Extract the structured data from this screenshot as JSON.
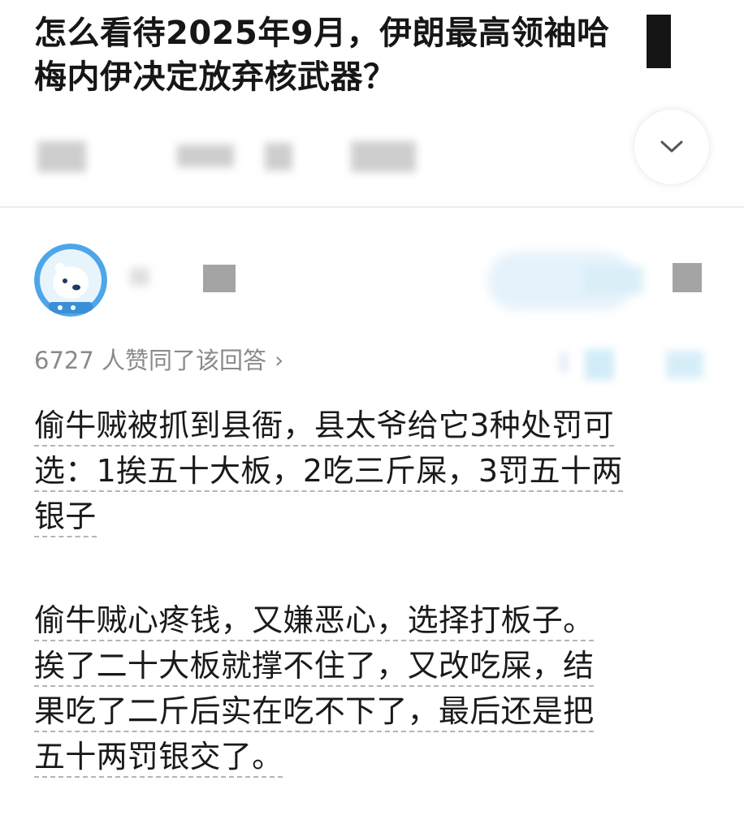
{
  "question": {
    "title_line1": "怎么看待2025年9月，伊朗最高领袖哈",
    "title_line2": "梅内伊决定放弃核武器？"
  },
  "icons": {
    "expand": "chevron-down-icon",
    "upvote_more": "chevron-right-icon",
    "avatar": "polar-bear-astronaut-avatar"
  },
  "answer": {
    "upvote_text": "6727 人赞同了该回答",
    "paragraph1": [
      "偷牛贼被抓到县衙，县太爷给它3种处罚可",
      "选：1挨五十大板，2吃三斤屎，3罚五十两",
      "银子"
    ],
    "paragraph2": [
      "偷牛贼心疼钱，又嫌恶心，选择打板子。",
      "挨了二十大板就撑不住了，又改吃屎，结",
      "果吃了二斤后实在吃不下了，最后还是把",
      "五十两罚银交了。"
    ]
  },
  "colors": {
    "title_text": "#161616",
    "body_text": "#1a1a1a",
    "muted_text": "#8a8a8a",
    "divider": "#ededed",
    "avatar_bg": "#4da6e8"
  }
}
